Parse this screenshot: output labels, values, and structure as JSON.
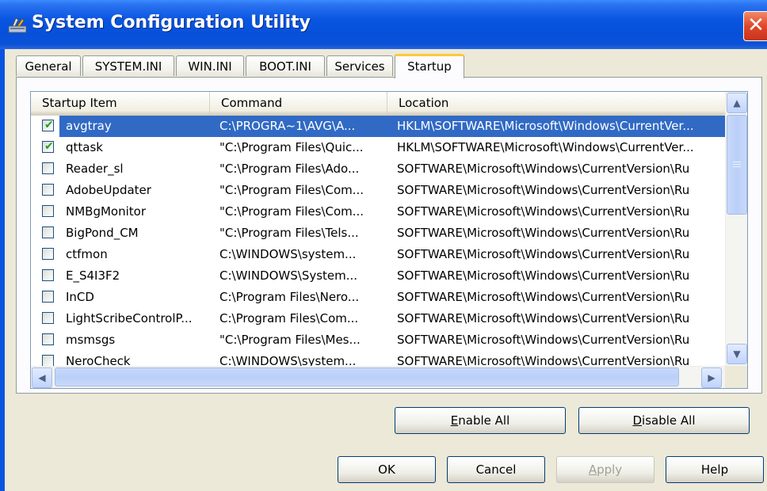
{
  "window": {
    "title": "System Configuration Utility",
    "close_glyph": "✕"
  },
  "tabs": [
    {
      "label": "General",
      "active": false
    },
    {
      "label": "SYSTEM.INI",
      "active": false
    },
    {
      "label": "WIN.INI",
      "active": false
    },
    {
      "label": "BOOT.INI",
      "active": false
    },
    {
      "label": "Services",
      "active": false
    },
    {
      "label": "Startup",
      "active": true
    }
  ],
  "list": {
    "columns": [
      "Startup Item",
      "Command",
      "Location"
    ],
    "rows": [
      {
        "checked": true,
        "item": "avgtray",
        "command": "C:\\PROGRA~1\\AVG\\A...",
        "location": "HKLM\\SOFTWARE\\Microsoft\\Windows\\CurrentVer...",
        "selected": true
      },
      {
        "checked": true,
        "item": "qttask",
        "command": "\"C:\\Program Files\\Quic...",
        "location": "HKLM\\SOFTWARE\\Microsoft\\Windows\\CurrentVer..."
      },
      {
        "checked": false,
        "item": "Reader_sl",
        "command": "\"C:\\Program Files\\Ado...",
        "location": "SOFTWARE\\Microsoft\\Windows\\CurrentVersion\\Ru"
      },
      {
        "checked": false,
        "item": "AdobeUpdater",
        "command": "\"C:\\Program Files\\Com...",
        "location": "SOFTWARE\\Microsoft\\Windows\\CurrentVersion\\Ru"
      },
      {
        "checked": false,
        "item": "NMBgMonitor",
        "command": "\"C:\\Program Files\\Com...",
        "location": "SOFTWARE\\Microsoft\\Windows\\CurrentVersion\\Ru"
      },
      {
        "checked": false,
        "item": "BigPond_CM",
        "command": "\"C:\\Program Files\\Tels...",
        "location": "SOFTWARE\\Microsoft\\Windows\\CurrentVersion\\Ru"
      },
      {
        "checked": false,
        "item": "ctfmon",
        "command": "C:\\WINDOWS\\system...",
        "location": "SOFTWARE\\Microsoft\\Windows\\CurrentVersion\\Ru"
      },
      {
        "checked": false,
        "item": "E_S4I3F2",
        "command": "C:\\WINDOWS\\System...",
        "location": "SOFTWARE\\Microsoft\\Windows\\CurrentVersion\\Ru"
      },
      {
        "checked": false,
        "item": "InCD",
        "command": "C:\\Program Files\\Nero...",
        "location": "SOFTWARE\\Microsoft\\Windows\\CurrentVersion\\Ru"
      },
      {
        "checked": false,
        "item": "LightScribeControlP...",
        "command": "C:\\Program Files\\Com...",
        "location": "SOFTWARE\\Microsoft\\Windows\\CurrentVersion\\Ru"
      },
      {
        "checked": false,
        "item": "msmsgs",
        "command": "\"C:\\Program Files\\Mes...",
        "location": "SOFTWARE\\Microsoft\\Windows\\CurrentVersion\\Ru"
      },
      {
        "checked": false,
        "item": "NeroCheck",
        "command": "C:\\WINDOWS\\system...",
        "location": "SOFTWARE\\Microsoft\\Windows\\CurrentVersion\\Ru"
      }
    ],
    "scroll": {
      "up": "▲",
      "down": "▼",
      "left": "◀",
      "right": "▶"
    }
  },
  "buttons": {
    "enable_all": "Enable All",
    "disable_all": "Disable All",
    "ok": "OK",
    "cancel": "Cancel",
    "apply": "Apply",
    "help": "Help"
  },
  "colors": {
    "selection": "#316AC5",
    "titlebar": "#0A55E0",
    "check": "#21A121"
  }
}
